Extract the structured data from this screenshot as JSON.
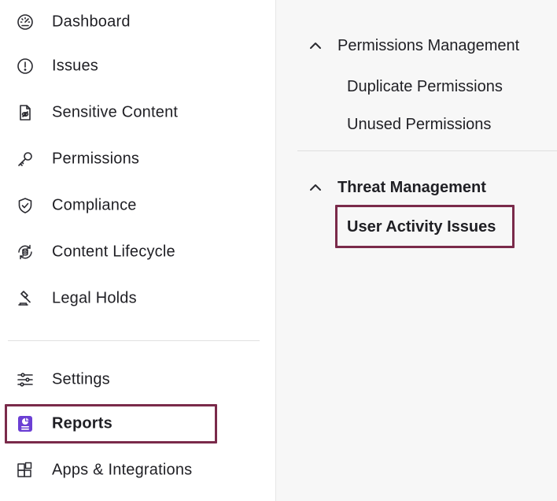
{
  "sidebar": {
    "items": [
      {
        "label": "Dashboard",
        "icon": "dashboard-gauge-icon"
      },
      {
        "label": "Issues",
        "icon": "alert-circle-icon"
      },
      {
        "label": "Sensitive Content",
        "icon": "sensitive-file-icon"
      },
      {
        "label": "Permissions",
        "icon": "key-icon"
      },
      {
        "label": "Compliance",
        "icon": "shield-check-icon"
      },
      {
        "label": "Content Lifecycle",
        "icon": "lifecycle-database-icon"
      },
      {
        "label": "Legal Holds",
        "icon": "gavel-icon"
      }
    ],
    "bottom_items": [
      {
        "label": "Settings",
        "icon": "sliders-icon"
      },
      {
        "label": "Reports",
        "icon": "report-icon",
        "active": true
      },
      {
        "label": "Apps & Integrations",
        "icon": "apps-grid-icon"
      }
    ]
  },
  "panel": {
    "groups": [
      {
        "title": "Permissions Management",
        "items": [
          "Duplicate Permissions",
          "Unused Permissions"
        ]
      },
      {
        "title": "Threat Management",
        "items": [
          "User Activity Issues"
        ]
      }
    ]
  },
  "colors": {
    "highlight_outline": "#7a2a4a",
    "reports_icon": "#6b3fd4",
    "panel_background": "#f7f7f7"
  }
}
